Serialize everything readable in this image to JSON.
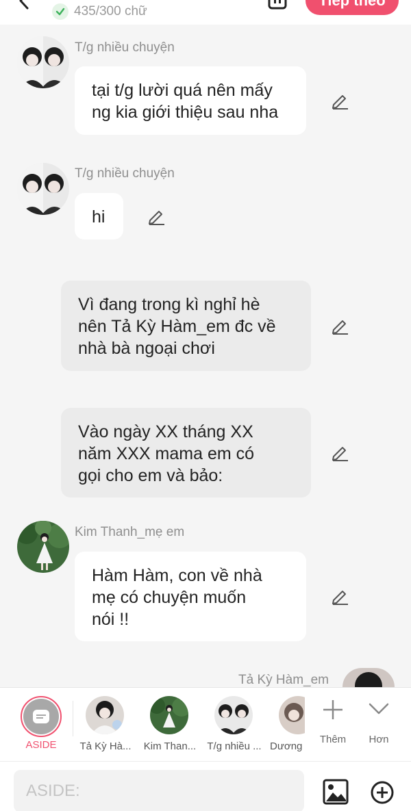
{
  "header": {
    "char_count": "435/300 chữ",
    "next_label": "Tiếp theo"
  },
  "messages": [
    {
      "type": "char",
      "sender": "T/g nhiều chuyện",
      "lines": [
        "tại t/g lười quá nên mấy",
        "ng kia giới thiệu sau nha"
      ]
    },
    {
      "type": "char",
      "sender": "T/g nhiều chuyện",
      "lines": [
        "hi"
      ]
    },
    {
      "type": "narration",
      "lines": [
        "Vì đang trong kì nghỉ hè",
        "nên Tả Kỳ Hàm_em đc về",
        "nhà bà ngoại chơi"
      ]
    },
    {
      "type": "narration",
      "lines": [
        "Vào ngày XX tháng XX",
        "năm XXX mama em có",
        "gọi cho em và bảo:"
      ]
    },
    {
      "type": "char",
      "sender": "Kim Thanh_mẹ em",
      "lines": [
        "Hàm Hàm, con về nhà",
        "mẹ có chuyện muốn",
        "nói !!"
      ]
    },
    {
      "type": "char-right",
      "sender": "Tả Kỳ Hàm_em"
    }
  ],
  "characters": {
    "aside_label": "ASIDE",
    "items": [
      {
        "label": "Tả Kỳ Hà..."
      },
      {
        "label": "Kim Than..."
      },
      {
        "label": "T/g nhiều ..."
      },
      {
        "label": "Dương"
      }
    ],
    "add_label": "Thêm",
    "more_label": "Hơn"
  },
  "composer": {
    "placeholder": "ASIDE:"
  },
  "colors": {
    "accent": "#f0506e",
    "bubble": "#ffffff",
    "narration_bubble": "#ebebeb",
    "background": "#f5f5f5"
  }
}
